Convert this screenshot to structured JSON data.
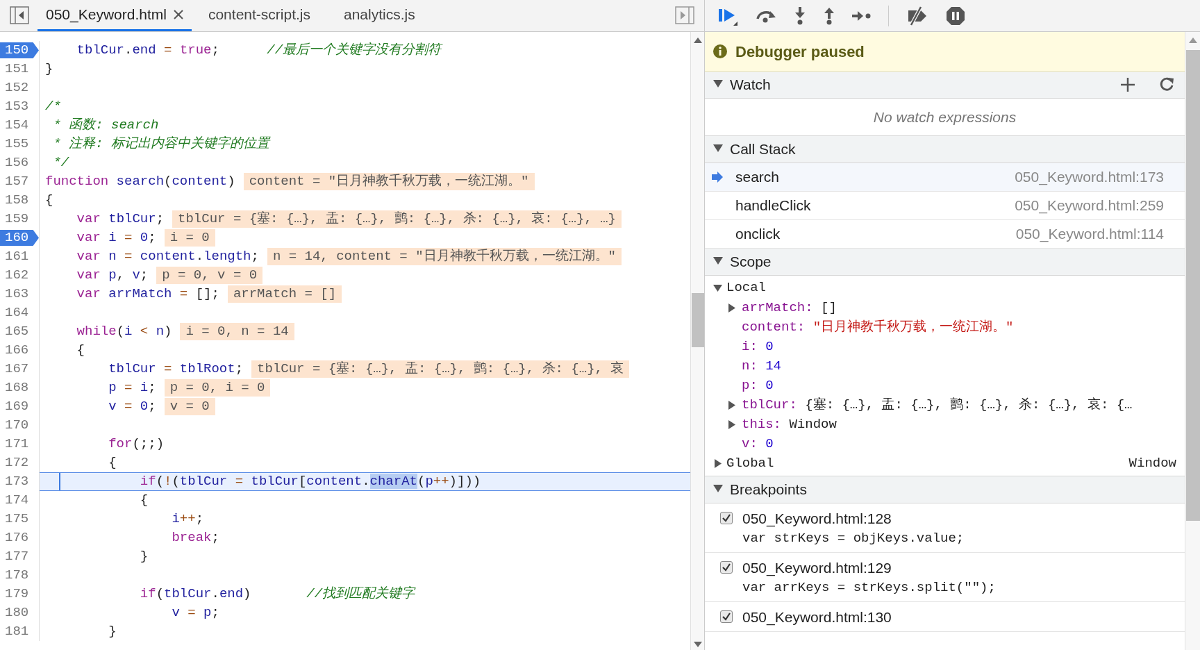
{
  "tabs": [
    {
      "label": "050_Keyword.html",
      "selected": true,
      "closable": true
    },
    {
      "label": "content-script.js",
      "selected": false,
      "closable": false
    },
    {
      "label": "analytics.js",
      "selected": false,
      "closable": false
    }
  ],
  "editor": {
    "lines": [
      {
        "number": "150",
        "breakpoint": true,
        "current": false,
        "segments": [
          {
            "text": "    tblCur",
            "kind": "id"
          },
          {
            "text": ".",
            "kind": "plain"
          },
          {
            "text": "end",
            "kind": "id"
          },
          {
            "text": " = ",
            "kind": "op"
          },
          {
            "text": "true",
            "kind": "kw"
          },
          {
            "text": ";",
            "kind": "plain"
          },
          {
            "text": "      //最后一个关键字没有分割符",
            "kind": "comment"
          }
        ]
      },
      {
        "number": "151",
        "breakpoint": false,
        "current": false,
        "segments": [
          {
            "text": "}",
            "kind": "plain"
          }
        ]
      },
      {
        "number": "152",
        "breakpoint": false,
        "current": false
      },
      {
        "number": "153",
        "breakpoint": false,
        "current": false,
        "segments": [
          {
            "text": "/*",
            "kind": "comment"
          }
        ]
      },
      {
        "number": "154",
        "breakpoint": false,
        "current": false,
        "segments": [
          {
            "text": " * 函数: search",
            "kind": "comment"
          }
        ]
      },
      {
        "number": "155",
        "breakpoint": false,
        "current": false,
        "segments": [
          {
            "text": " * 注释: 标记出内容中关键字的位置",
            "kind": "comment"
          }
        ]
      },
      {
        "number": "156",
        "breakpoint": false,
        "current": false,
        "segments": [
          {
            "text": " */",
            "kind": "comment"
          }
        ]
      },
      {
        "number": "157",
        "breakpoint": false,
        "current": false,
        "segments": [
          {
            "text": "function",
            "kind": "kw"
          },
          {
            "text": " search",
            "kind": "id"
          },
          {
            "text": "(",
            "kind": "plain"
          },
          {
            "text": "content",
            "kind": "id"
          },
          {
            "text": ")",
            "kind": "plain"
          }
        ],
        "inline_value": "content = \"日月神教千秋万载，一统江湖。\""
      },
      {
        "number": "158",
        "breakpoint": false,
        "current": false,
        "segments": [
          {
            "text": "{",
            "kind": "plain"
          }
        ]
      },
      {
        "number": "159",
        "breakpoint": false,
        "current": false,
        "segments": [
          {
            "text": "    var",
            "kind": "kw"
          },
          {
            "text": " tblCur",
            "kind": "id"
          },
          {
            "text": ";",
            "kind": "plain"
          }
        ],
        "inline_value": "tblCur = {塞: {…}, 盂: {…}, 鹯: {…}, 杀: {…}, 哀: {…}, …}"
      },
      {
        "number": "160",
        "breakpoint": true,
        "current": false,
        "segments": [
          {
            "text": "    var",
            "kind": "kw"
          },
          {
            "text": " i",
            "kind": "id"
          },
          {
            "text": " = ",
            "kind": "op"
          },
          {
            "text": "0",
            "kind": "num"
          },
          {
            "text": ";",
            "kind": "plain"
          }
        ],
        "inline_value": "i = 0"
      },
      {
        "number": "161",
        "breakpoint": false,
        "current": false,
        "segments": [
          {
            "text": "    var",
            "kind": "kw"
          },
          {
            "text": " n",
            "kind": "id"
          },
          {
            "text": " = ",
            "kind": "op"
          },
          {
            "text": "content",
            "kind": "id"
          },
          {
            "text": ".",
            "kind": "plain"
          },
          {
            "text": "length",
            "kind": "id"
          },
          {
            "text": ";",
            "kind": "plain"
          }
        ],
        "inline_value": "n = 14, content = \"日月神教千秋万载，一统江湖。\""
      },
      {
        "number": "162",
        "breakpoint": false,
        "current": false,
        "segments": [
          {
            "text": "    var",
            "kind": "kw"
          },
          {
            "text": " p",
            "kind": "id"
          },
          {
            "text": ", ",
            "kind": "plain"
          },
          {
            "text": "v",
            "kind": "id"
          },
          {
            "text": ";",
            "kind": "plain"
          }
        ],
        "inline_value": "p = 0, v = 0"
      },
      {
        "number": "163",
        "breakpoint": false,
        "current": false,
        "segments": [
          {
            "text": "    var",
            "kind": "kw"
          },
          {
            "text": " arrMatch",
            "kind": "id"
          },
          {
            "text": " = ",
            "kind": "op"
          },
          {
            "text": "[];",
            "kind": "plain"
          }
        ],
        "inline_value": "arrMatch = []"
      },
      {
        "number": "164",
        "breakpoint": false,
        "current": false
      },
      {
        "number": "165",
        "breakpoint": false,
        "current": false,
        "segments": [
          {
            "text": "    while",
            "kind": "kw"
          },
          {
            "text": "(",
            "kind": "plain"
          },
          {
            "text": "i",
            "kind": "id"
          },
          {
            "text": " < ",
            "kind": "op"
          },
          {
            "text": "n",
            "kind": "id"
          },
          {
            "text": ")",
            "kind": "plain"
          }
        ],
        "inline_value": "i = 0, n = 14"
      },
      {
        "number": "166",
        "breakpoint": false,
        "current": false,
        "segments": [
          {
            "text": "    {",
            "kind": "plain"
          }
        ]
      },
      {
        "number": "167",
        "breakpoint": false,
        "current": false,
        "segments": [
          {
            "text": "        tblCur",
            "kind": "id"
          },
          {
            "text": " = ",
            "kind": "op"
          },
          {
            "text": "tblRoot",
            "kind": "id"
          },
          {
            "text": ";",
            "kind": "plain"
          }
        ],
        "inline_value": "tblCur = {塞: {…}, 盂: {…}, 鹯: {…}, 杀: {…}, 哀"
      },
      {
        "number": "168",
        "breakpoint": false,
        "current": false,
        "segments": [
          {
            "text": "        p",
            "kind": "id"
          },
          {
            "text": " = ",
            "kind": "op"
          },
          {
            "text": "i",
            "kind": "id"
          },
          {
            "text": ";",
            "kind": "plain"
          }
        ],
        "inline_value": "p = 0, i = 0"
      },
      {
        "number": "169",
        "breakpoint": false,
        "current": false,
        "segments": [
          {
            "text": "        v",
            "kind": "id"
          },
          {
            "text": " = ",
            "kind": "op"
          },
          {
            "text": "0",
            "kind": "num"
          },
          {
            "text": ";",
            "kind": "plain"
          }
        ],
        "inline_value": "v = 0"
      },
      {
        "number": "170",
        "breakpoint": false,
        "current": false
      },
      {
        "number": "171",
        "breakpoint": false,
        "current": false,
        "segments": [
          {
            "text": "        for",
            "kind": "kw"
          },
          {
            "text": "(;;)",
            "kind": "plain"
          }
        ]
      },
      {
        "number": "172",
        "breakpoint": false,
        "current": false,
        "segments": [
          {
            "text": "        {",
            "kind": "plain"
          }
        ]
      },
      {
        "number": "173",
        "breakpoint": false,
        "current": true,
        "segments": [
          {
            "text": "            if",
            "kind": "kw"
          },
          {
            "text": "(",
            "kind": "plain"
          },
          {
            "text": "!",
            "kind": "op"
          },
          {
            "text": "(",
            "kind": "plain"
          },
          {
            "text": "tblCur",
            "kind": "id"
          },
          {
            "text": " = ",
            "kind": "op"
          },
          {
            "text": "tblCur",
            "kind": "id"
          },
          {
            "text": "[",
            "kind": "plain"
          },
          {
            "text": "content",
            "kind": "id"
          },
          {
            "text": ".",
            "kind": "plain"
          },
          {
            "text": "charAt",
            "kind": "selection"
          },
          {
            "text": "(",
            "kind": "plain"
          },
          {
            "text": "p",
            "kind": "id"
          },
          {
            "text": "++",
            "kind": "op"
          },
          {
            "text": ")]))",
            "kind": "plain"
          }
        ]
      },
      {
        "number": "174",
        "breakpoint": false,
        "current": false,
        "segments": [
          {
            "text": "            {",
            "kind": "plain"
          }
        ]
      },
      {
        "number": "175",
        "breakpoint": false,
        "current": false,
        "segments": [
          {
            "text": "                i",
            "kind": "id"
          },
          {
            "text": "++",
            "kind": "op"
          },
          {
            "text": ";",
            "kind": "plain"
          }
        ]
      },
      {
        "number": "176",
        "breakpoint": false,
        "current": false,
        "segments": [
          {
            "text": "                break",
            "kind": "kw"
          },
          {
            "text": ";",
            "kind": "plain"
          }
        ]
      },
      {
        "number": "177",
        "breakpoint": false,
        "current": false,
        "segments": [
          {
            "text": "            }",
            "kind": "plain"
          }
        ]
      },
      {
        "number": "178",
        "breakpoint": false,
        "current": false
      },
      {
        "number": "179",
        "breakpoint": false,
        "current": false,
        "segments": [
          {
            "text": "            if",
            "kind": "kw"
          },
          {
            "text": "(",
            "kind": "plain"
          },
          {
            "text": "tblCur",
            "kind": "id"
          },
          {
            "text": ".",
            "kind": "plain"
          },
          {
            "text": "end",
            "kind": "id"
          },
          {
            "text": ")",
            "kind": "plain"
          },
          {
            "text": "       //找到匹配关键字",
            "kind": "comment"
          }
        ]
      },
      {
        "number": "180",
        "breakpoint": false,
        "current": false,
        "segments": [
          {
            "text": "                v",
            "kind": "id"
          },
          {
            "text": " = ",
            "kind": "op"
          },
          {
            "text": "p",
            "kind": "id"
          },
          {
            "text": ";",
            "kind": "plain"
          }
        ]
      },
      {
        "number": "181",
        "breakpoint": false,
        "current": false,
        "segments": [
          {
            "text": "        }",
            "kind": "plain"
          }
        ]
      }
    ]
  },
  "debugger": {
    "status": "Debugger paused",
    "watch": {
      "title": "Watch",
      "expanded": true,
      "empty_text": "No watch expressions"
    },
    "call_stack": {
      "title": "Call Stack",
      "expanded": true,
      "frames": [
        {
          "name": "search",
          "location": "050_Keyword.html:173",
          "selected": true
        },
        {
          "name": "handleClick",
          "location": "050_Keyword.html:259",
          "selected": false
        },
        {
          "name": "onclick",
          "location": "050_Keyword.html:114",
          "selected": false
        }
      ]
    },
    "scope": {
      "title": "Scope",
      "expanded": true,
      "groups": [
        {
          "name": "Local",
          "expanded": true,
          "children": [
            {
              "name": "arrMatch:",
              "value": "[]",
              "kind": "object",
              "expanded": false
            },
            {
              "name": "content:",
              "value": "\"日月神教千秋万载，一统江湖。\"",
              "kind": "string"
            },
            {
              "name": "i:",
              "value": "0",
              "kind": "number"
            },
            {
              "name": "n:",
              "value": "14",
              "kind": "number"
            },
            {
              "name": "p:",
              "value": "0",
              "kind": "number"
            },
            {
              "name": "tblCur:",
              "value": "{塞: {…}, 盂: {…}, 鹯: {…}, 杀: {…}, 哀: {…",
              "kind": "object",
              "expanded": false
            },
            {
              "name": "this:",
              "value": "Window",
              "kind": "object",
              "expanded": false
            },
            {
              "name": "v:",
              "value": "0",
              "kind": "number"
            }
          ]
        },
        {
          "name": "Global",
          "value": "Window",
          "expanded": false
        }
      ]
    },
    "breakpoints": {
      "title": "Breakpoints",
      "expanded": true,
      "items": [
        {
          "location": "050_Keyword.html:128",
          "code": "var strKeys = objKeys.value;",
          "checked": true
        },
        {
          "location": "050_Keyword.html:129",
          "code": "var arrKeys = strKeys.split(\"\");",
          "checked": true
        },
        {
          "location": "050_Keyword.html:130",
          "checked": true
        }
      ]
    }
  }
}
